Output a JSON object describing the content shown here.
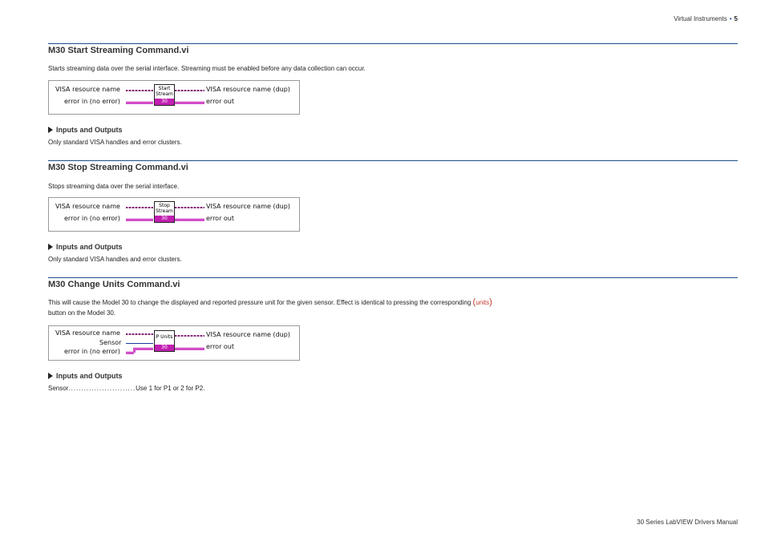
{
  "header": {
    "text": "Virtual Instruments",
    "page": "5"
  },
  "footer": {
    "text": "30 Series LabVIEW Drivers Manual"
  },
  "sections": [
    {
      "title": "M30 Start Streaming Command.vi",
      "description": "Starts streaming data over the serial interface. Streaming must be enabled before any data collection can occur.",
      "diagram": {
        "in1": "VISA resource name",
        "in2": "error in (no error)",
        "icon_line1": "Start",
        "icon_line2": "Stream",
        "icon_num": "30",
        "out1": "VISA resource name (dup)",
        "out2": "error out"
      },
      "io_heading": "Inputs and Outputs",
      "io_text": "Only standard VISA handles and error clusters."
    },
    {
      "title": "M30 Stop Streaming Command.vi",
      "description": "Stops streaming data over the serial interface.",
      "diagram": {
        "in1": "VISA resource name",
        "in2": "error in (no error)",
        "icon_line1": "Stop",
        "icon_line2": "Stream",
        "icon_num": "30",
        "out1": "VISA resource name (dup)",
        "out2": "error out"
      },
      "io_heading": "Inputs and Outputs",
      "io_text": "Only standard VISA handles and error clusters."
    },
    {
      "title": "M30 Change Units Command.vi",
      "description_a": "This will cause the Model 30 to change the displayed and reported pressure unit for the given sensor. Effect is identical to pressing the corresponding",
      "units_open": "(",
      "units_word": "units",
      "units_close": ")",
      "description_b": "button on the Model 30.",
      "diagram": {
        "in1": "VISA resource name",
        "in_sensor": "Sensor",
        "in2": "error in (no error)",
        "icon_line1": "P Units",
        "icon_num": "30",
        "out1": "VISA resource name (dup)",
        "out2": "error out"
      },
      "io_heading": "Inputs and Outputs",
      "io_term": "Sensor",
      "io_dots": "..........................",
      "io_value": "Use 1 for P1 or 2 for P2."
    }
  ]
}
